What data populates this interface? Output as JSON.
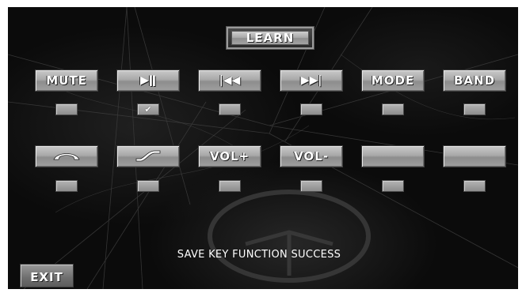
{
  "learn_button": {
    "label": "LEARN"
  },
  "row1": [
    {
      "key": "mute",
      "label": "MUTE",
      "icon": "",
      "checked": false
    },
    {
      "key": "play-pause",
      "label": "",
      "icon": "play-pause-icon",
      "glyph": "▶ǁ",
      "checked": true,
      "check_glyph": "✔"
    },
    {
      "key": "previous",
      "label": "",
      "icon": "skip-previous-icon",
      "glyph": "|◀◀",
      "checked": false
    },
    {
      "key": "next",
      "label": "",
      "icon": "skip-next-icon",
      "glyph": "▶▶|",
      "checked": false
    },
    {
      "key": "mode",
      "label": "MODE",
      "icon": "",
      "checked": false
    },
    {
      "key": "band",
      "label": "BAND",
      "icon": "",
      "checked": false
    }
  ],
  "row2": [
    {
      "key": "hang-up",
      "label": "",
      "icon": "phone-hangup-icon",
      "checked": false
    },
    {
      "key": "answer",
      "label": "",
      "icon": "phone-answer-icon",
      "checked": false
    },
    {
      "key": "vol-up",
      "label": "VOL+",
      "icon": "",
      "checked": false
    },
    {
      "key": "vol-down",
      "label": "VOL-",
      "icon": "",
      "checked": false
    },
    {
      "key": "blank-1",
      "label": "",
      "icon": "",
      "checked": false
    },
    {
      "key": "blank-2",
      "label": "",
      "icon": "",
      "checked": false
    }
  ],
  "status": {
    "message": "SAVE KEY FUNCTION SUCCESS"
  },
  "exit_button": {
    "label": "EXIT"
  },
  "colors": {
    "background": "#0b0b0b",
    "button_face": "#a9a9a9",
    "text": "#ffffff"
  }
}
